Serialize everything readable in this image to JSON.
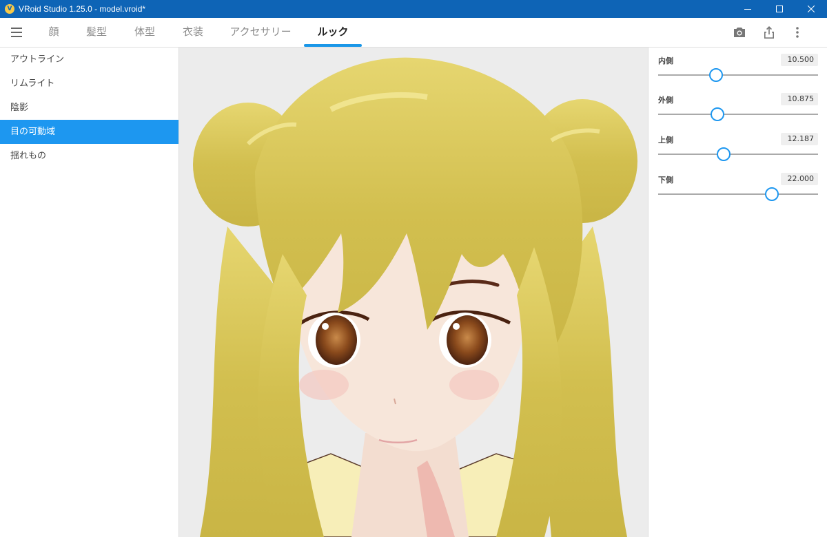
{
  "window": {
    "title": "VRoid Studio 1.25.0 - model.vroid*",
    "logo_letter": "V",
    "controls": [
      "minimize-icon",
      "maximize-icon",
      "close-icon"
    ]
  },
  "nav": {
    "menu_icon": "hamburger-menu-icon",
    "tabs": [
      {
        "label": "顔",
        "active": false
      },
      {
        "label": "髪型",
        "active": false
      },
      {
        "label": "体型",
        "active": false
      },
      {
        "label": "衣装",
        "active": false
      },
      {
        "label": "アクセサリー",
        "active": false
      },
      {
        "label": "ルック",
        "active": true
      }
    ],
    "tools": [
      "camera-icon",
      "export-icon",
      "more-vertical-icon"
    ]
  },
  "sidebar": {
    "items": [
      {
        "label": "アウトライン",
        "active": false
      },
      {
        "label": "リムライト",
        "active": false
      },
      {
        "label": "陰影",
        "active": false
      },
      {
        "label": "目の可動域",
        "active": true
      },
      {
        "label": "揺れもの",
        "active": false
      }
    ]
  },
  "panel": {
    "sliders": [
      {
        "label": "内側",
        "value": "10.500",
        "level": 0.36
      },
      {
        "label": "外側",
        "value": "10.875",
        "level": 0.37
      },
      {
        "label": "上側",
        "value": "12.187",
        "level": 0.41
      },
      {
        "label": "下側",
        "value": "22.000",
        "level": 0.71
      }
    ]
  },
  "colors": {
    "titlebar": "#0e64b6",
    "accent": "#1d97f0",
    "hair": "#d9c85a",
    "skin": "#f7e6da",
    "eye": "#8a4a1c"
  }
}
